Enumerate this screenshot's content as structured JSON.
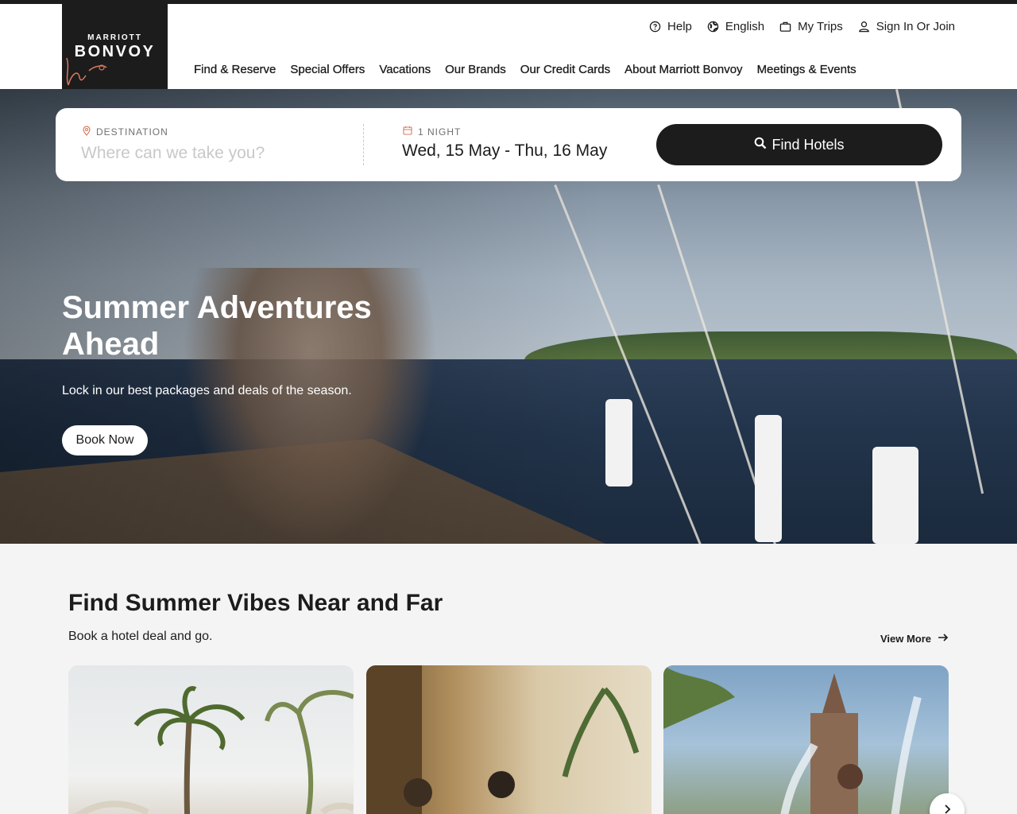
{
  "brand": {
    "top": "MARRIOTT",
    "main": "BONVOY"
  },
  "utility": {
    "help": "Help",
    "language": "English",
    "trips": "My Trips",
    "signin": "Sign In Or Join"
  },
  "nav": {
    "items": [
      {
        "label": "Find & Reserve"
      },
      {
        "label": "Special Offers"
      },
      {
        "label": "Vacations"
      },
      {
        "label": "Our Brands"
      },
      {
        "label": "Our Credit Cards"
      },
      {
        "label": "About Marriott Bonvoy"
      },
      {
        "label": "Meetings & Events"
      }
    ]
  },
  "search": {
    "destination_label": "DESTINATION",
    "destination_placeholder": "Where can we take you?",
    "nights_label": "1 NIGHT",
    "dates": "Wed, 15 May - Thu, 16 May",
    "button": "Find Hotels"
  },
  "hero": {
    "title": "Summer Adventures Ahead",
    "subtitle": "Lock in our best packages and deals of the season.",
    "cta": "Book Now"
  },
  "deals": {
    "title": "Find Summer Vibes Near and Far",
    "subtitle": "Book a hotel deal and go.",
    "view_more": "View More"
  },
  "colors": {
    "ink": "#1c1c1c",
    "accent": "#d87a5f",
    "surface": "#f4f4f4"
  }
}
